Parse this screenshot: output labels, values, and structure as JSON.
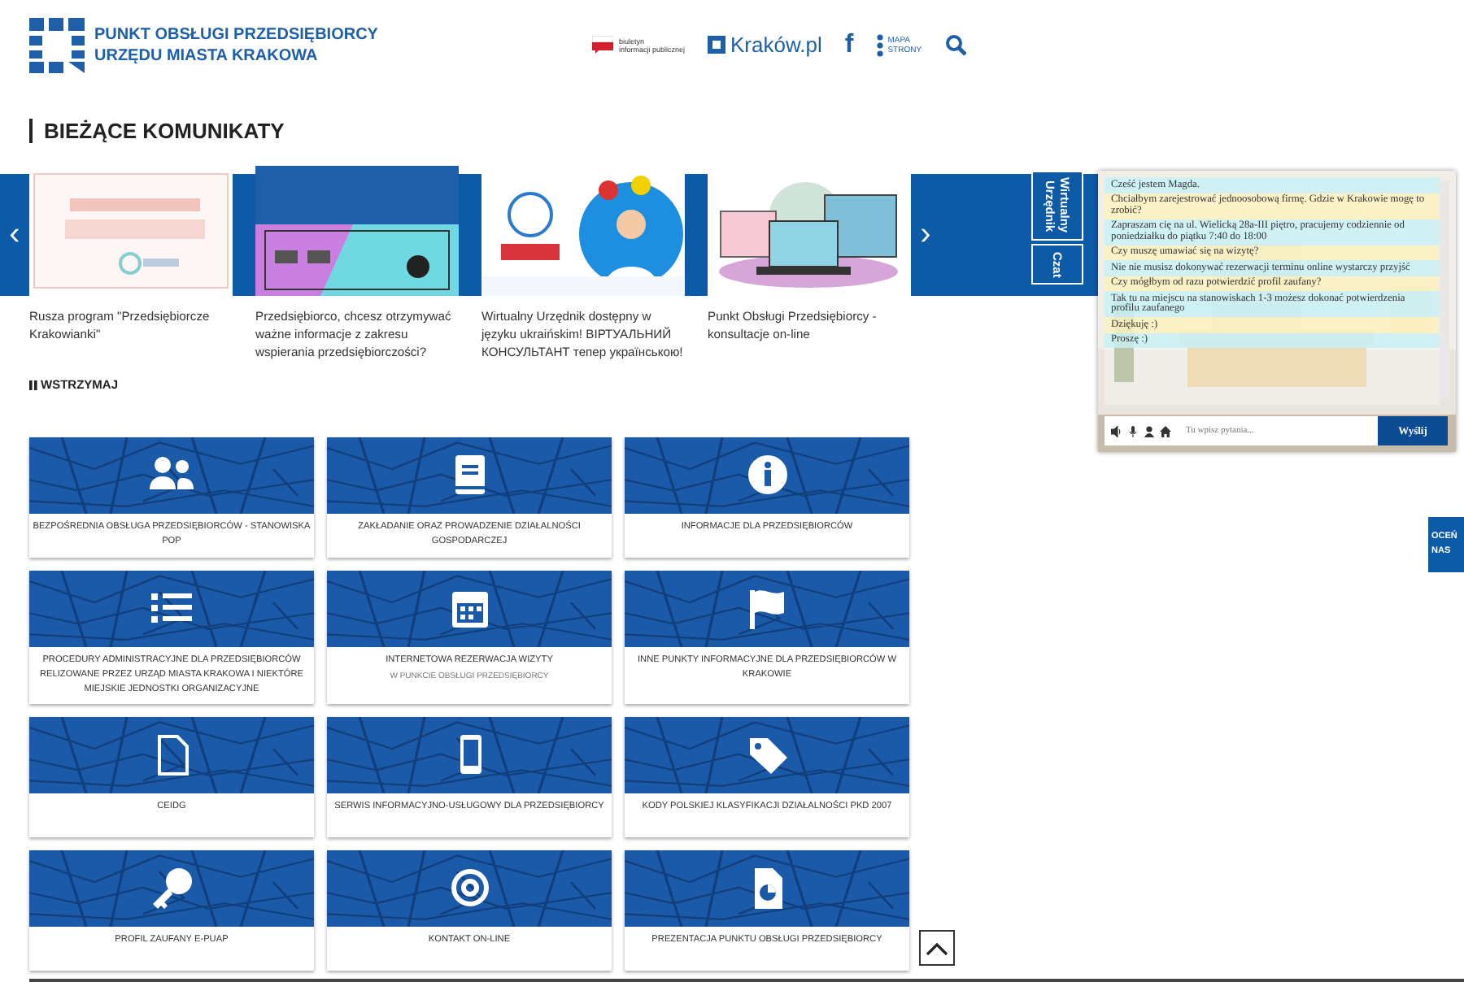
{
  "header": {
    "title_lines": [
      "PUNKT OBSŁUGI PRZEDSIĘBIORCY",
      "URZĘDU MIASTA KRAKOWA"
    ],
    "bip_lines": [
      "biuletyn",
      "informacji publicznej"
    ],
    "city_link": "Kraków.pl",
    "facebook": "f",
    "sitemap_lines": [
      "MAPA",
      "STRONY"
    ]
  },
  "section_title": "BIEŻĄCE KOMUNIKATY",
  "carousel": {
    "prev": "‹",
    "next": "›",
    "pause": "WSTRZYMAJ",
    "slides": [
      {
        "caption": "Rusza program \"Przedsiębiorcze Krakowianki\""
      },
      {
        "caption": "Przedsiębiorco, chcesz otrzymywać ważne informacje z zakresu wspierania przedsiębiorczości?"
      },
      {
        "caption": "Wirtualny Urzędnik dostępny w języku ukraińskim! ВІРТУАЛЬНИЙ КОНСУЛЬТАНТ тепер українською!"
      },
      {
        "caption": "Punkt Obsługi Przedsiębiorcy - konsultacje on-line"
      }
    ]
  },
  "side_tabs": [
    {
      "label": "Wirtualny Urzędnik"
    },
    {
      "label": "Czat"
    }
  ],
  "chat": {
    "messages": [
      {
        "kind": "bot",
        "text": "Cześć jestem Magda."
      },
      {
        "kind": "user",
        "text": "Chciałbym zarejestrować jednoosobową firmę. Gdzie w Krakowie mogę to zrobić?"
      },
      {
        "kind": "bot",
        "text": "Zapraszam cię na ul. Wielicką 28a-III piętro, pracujemy codziennie od poniedziałku do piątku 7:40 do 18:00"
      },
      {
        "kind": "user",
        "text": "Czy muszę umawiać się na wizytę?"
      },
      {
        "kind": "bot",
        "text": "Nie nie musisz dokonywać rezerwacji terminu online wystarczy przyjść"
      },
      {
        "kind": "user",
        "text": "Czy mógłbym od razu potwierdzić profil zaufany?"
      },
      {
        "kind": "bot",
        "text": "Tak tu na miejscu na stanowiskach 1-3 możesz dokonać potwierdzenia profilu zaufanego"
      },
      {
        "kind": "user",
        "text": "Dziękuję :)"
      },
      {
        "kind": "bot",
        "text": "Proszę :)"
      }
    ],
    "input": {
      "placeholder": "Tu wpisz pytania..."
    },
    "send": "Wyślij"
  },
  "rate_tab": "OCEŃ NAS",
  "tiles": [
    {
      "title": "BEZPOŚREDNIA OBSŁUGA PRZEDSIĘBIORCÓW - STANOWISKA POP"
    },
    {
      "title": "ZAKŁADANIE ORAZ PROWADZENIE DZIAŁALNOŚCI GOSPODARCZEJ"
    },
    {
      "title": "INFORMACJE DLA PRZEDSIĘBIORCÓW"
    },
    {
      "title": "PROCEDURY ADMINISTRACYJNE DLA PRZEDSIĘBIORCÓW RELIZOWANE PRZEZ URZĄD MIASTA KRAKOWA I NIEKTÓRE MIEJSKIE JEDNOSTKI ORGANIZACYJNE"
    },
    {
      "title": "INTERNETOWA REZERWACJA WIZYTY",
      "subtitle": "W PUNKCIE OBSŁUGI PRZEDSIĘBIORCY"
    },
    {
      "title": "INNE PUNKTY INFORMACYJNE DLA PRZEDSIĘBIORCÓW W KRAKOWIE"
    },
    {
      "title": "CEIDG"
    },
    {
      "title": "SERWIS INFORMACYJNO-USŁUGOWY DLA PRZEDSIĘBIORCY"
    },
    {
      "title": "KODY POLSKIEJ KLASYFIKACJI DZIAŁALNOŚCI PKD 2007"
    },
    {
      "title": "PROFIL ZAUFANY E-PUAP"
    },
    {
      "title": "KONTAKT ON-LINE"
    },
    {
      "title": "PREZENTACJA PUNKTU OBSŁUGI PRZEDSIĘBIORCY"
    }
  ]
}
